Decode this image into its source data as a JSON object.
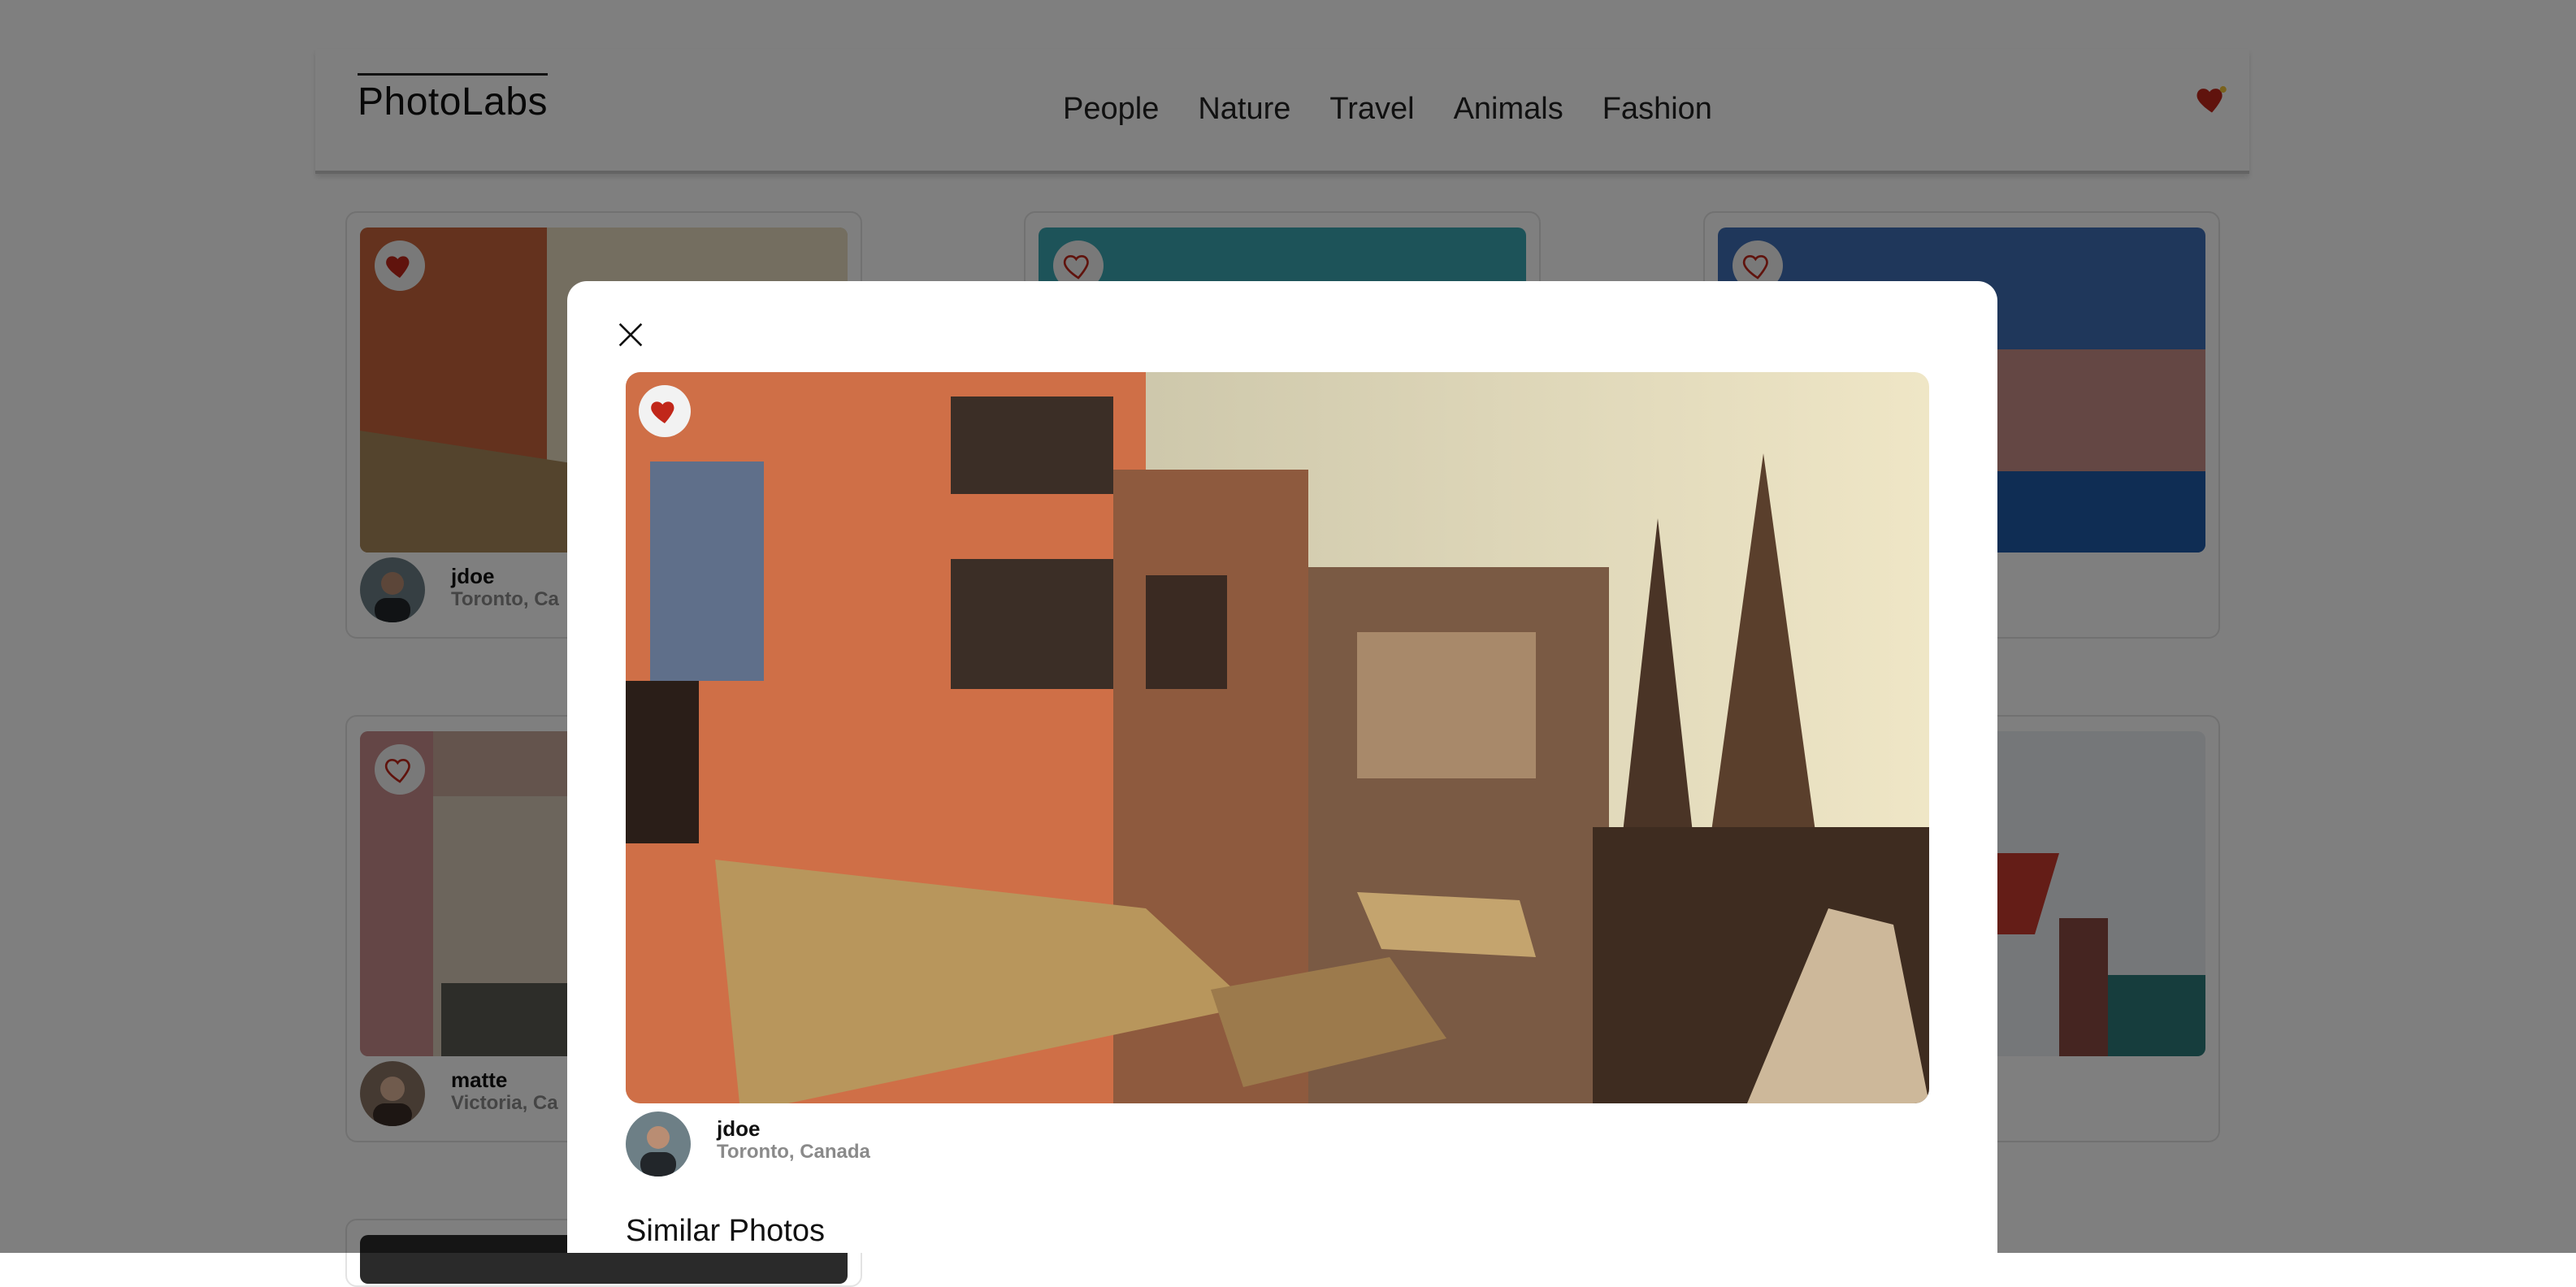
{
  "app": {
    "logo": "PhotoLabs"
  },
  "nav": {
    "topics": [
      "People",
      "Nature",
      "Travel",
      "Animals",
      "Fashion"
    ]
  },
  "grid": {
    "cards": [
      {
        "username": "jdoe",
        "location": "Toronto, Ca"
      },
      {
        "username": "matte",
        "location": "Victoria, Ca"
      }
    ]
  },
  "modal": {
    "username": "jdoe",
    "location": "Toronto, Canada",
    "similar_heading": "Similar Photos"
  },
  "colors": {
    "heart": "#c1271a",
    "accent_nav_border": "#c9c9c9"
  },
  "icons": {
    "close": "close-icon",
    "heart": "heart-icon"
  }
}
